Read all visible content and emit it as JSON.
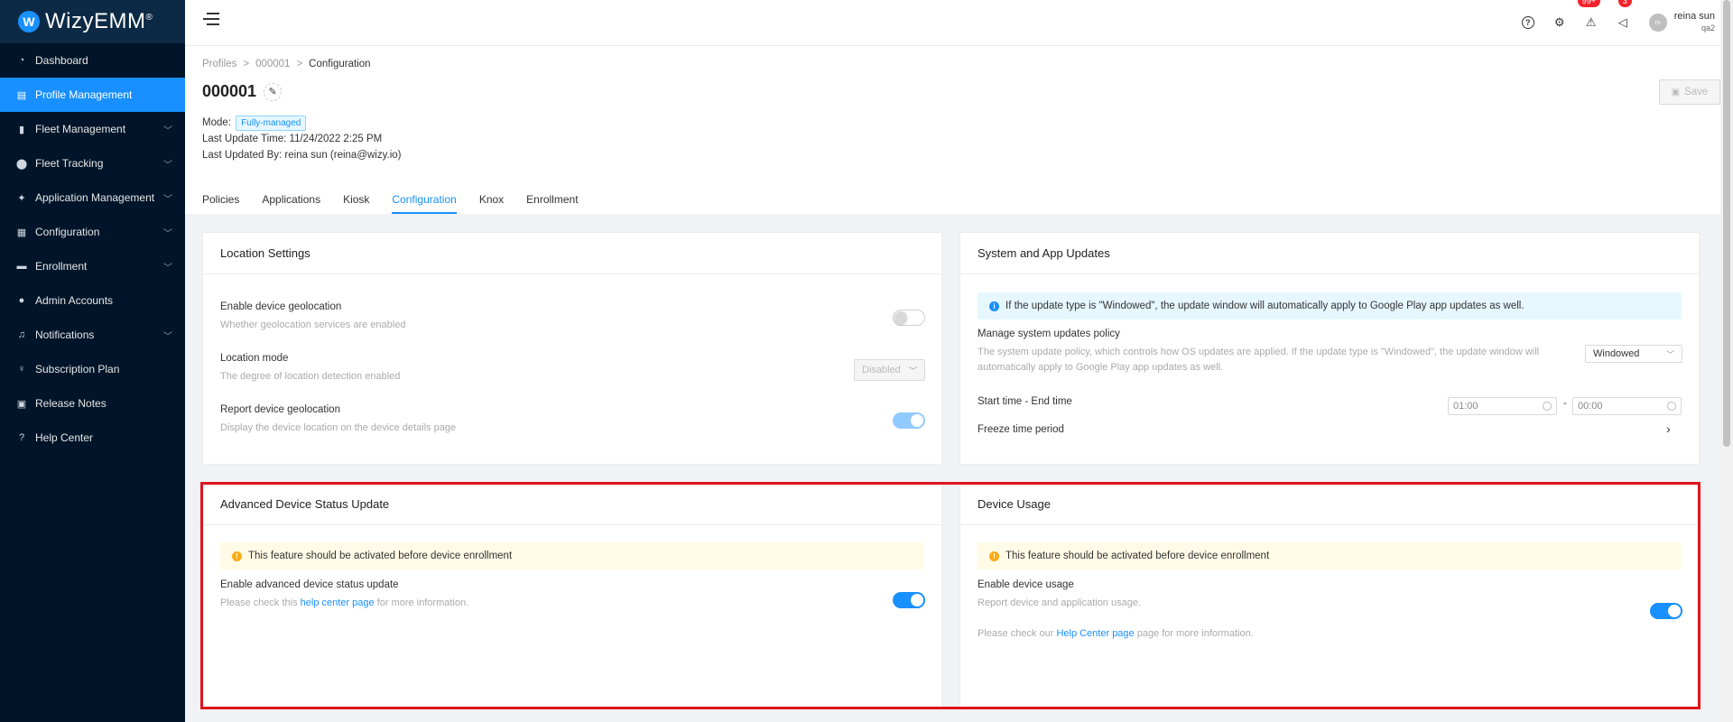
{
  "app": {
    "brand_initial": "W",
    "brand_name": "WizyEMM",
    "brand_mark": "®"
  },
  "sidebar": {
    "items": [
      {
        "label": "Dashboard",
        "icon": "dashboard-icon",
        "glyph": "◔",
        "expandable": false,
        "active": false
      },
      {
        "label": "Profile Management",
        "icon": "profile-icon",
        "glyph": "▤",
        "expandable": false,
        "active": true
      },
      {
        "label": "Fleet Management",
        "icon": "device-icon",
        "glyph": "▮",
        "expandable": true,
        "active": false
      },
      {
        "label": "Fleet Tracking",
        "icon": "location-pin-icon",
        "glyph": "⬤",
        "expandable": true,
        "active": false
      },
      {
        "label": "Application Management",
        "icon": "android-icon",
        "glyph": "✦",
        "expandable": true,
        "active": false
      },
      {
        "label": "Configuration",
        "icon": "configuration-icon",
        "glyph": "▦",
        "expandable": true,
        "active": false
      },
      {
        "label": "Enrollment",
        "icon": "enrollment-icon",
        "glyph": "▬",
        "expandable": true,
        "active": false
      },
      {
        "label": "Admin Accounts",
        "icon": "admin-icon",
        "glyph": "●",
        "expandable": false,
        "active": false
      },
      {
        "label": "Notifications",
        "icon": "bell-icon",
        "glyph": "♫",
        "expandable": true,
        "active": false
      },
      {
        "label": "Subscription Plan",
        "icon": "bulb-icon",
        "glyph": "♀",
        "expandable": false,
        "active": false
      },
      {
        "label": "Release Notes",
        "icon": "calendar-icon",
        "glyph": "▣",
        "expandable": false,
        "active": false
      },
      {
        "label": "Help Center",
        "icon": "help-icon",
        "glyph": "?",
        "expandable": false,
        "active": false
      }
    ]
  },
  "header": {
    "alerts_badge": "99+",
    "announcements_badge": "3",
    "user_initials": "rs",
    "user_name": "reina sun",
    "user_org": "qa2"
  },
  "breadcrumb": {
    "items": [
      "Profiles",
      "000001"
    ],
    "current": "Configuration",
    "separator": ">"
  },
  "page": {
    "title": "000001",
    "mode_label": "Mode:",
    "mode_value": "Fully-managed",
    "last_update_time": "Last Update Time: 11/24/2022 2:25 PM",
    "last_updated_by": "Last Updated By: reina sun (reina@wizy.io)",
    "save_label": "Save"
  },
  "tabs": [
    {
      "label": "Policies",
      "active": false
    },
    {
      "label": "Applications",
      "active": false
    },
    {
      "label": "Kiosk",
      "active": false
    },
    {
      "label": "Configuration",
      "active": true
    },
    {
      "label": "Knox",
      "active": false
    },
    {
      "label": "Enrollment",
      "active": false
    }
  ],
  "location": {
    "title": "Location Settings",
    "geo_title": "Enable device geolocation",
    "geo_desc": "Whether geolocation services are enabled",
    "geo_enabled": false,
    "mode_title": "Location mode",
    "mode_desc": "The degree of location detection enabled",
    "mode_value": "Disabled",
    "report_title": "Report device geolocation",
    "report_desc": "Display the device location on the device details page",
    "report_enabled": true
  },
  "updates": {
    "title": "System and App Updates",
    "info": "If the update type is \"Windowed\", the update window will automatically apply to Google Play app updates as well.",
    "policy_title": "Manage system updates policy",
    "policy_desc": "The system update policy, which controls how OS updates are applied. If the update type is \"Windowed\", the update window will automatically apply to Google Play app updates as well.",
    "policy_value": "Windowed",
    "time_title": "Start time - End time",
    "start_time": "01:00",
    "time_sep": "-",
    "end_time": "00:00",
    "freeze_title": "Freeze time period"
  },
  "advanced": {
    "title": "Advanced Device Status Update",
    "warning": "This feature should be activated before device enrollment",
    "enable_title": "Enable advanced device status update",
    "desc_prefix": "Please check this ",
    "desc_link": "help center page",
    "desc_suffix": " for more information.",
    "enabled": true
  },
  "usage": {
    "title": "Device Usage",
    "warning": "This feature should be activated before device enrollment",
    "enable_title": "Enable device usage",
    "enable_desc": "Report device and application usage.",
    "note_prefix": "Please check our ",
    "note_link": "Help Center page",
    "note_suffix": " page for more information.",
    "enabled": true
  },
  "colors": {
    "accent": "#1890ff",
    "sidebar_bg": "#001529",
    "highlight": "#e0141e",
    "warning": "#faad14"
  }
}
